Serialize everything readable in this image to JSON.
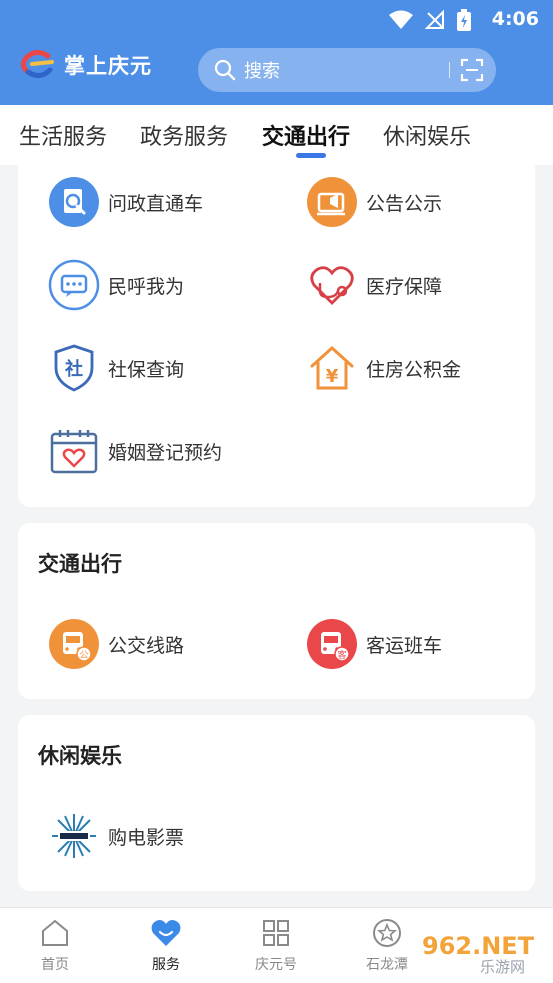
{
  "status": {
    "time": "4:06"
  },
  "header": {
    "app_name": "掌上庆元",
    "search_placeholder": "搜索"
  },
  "tabs": [
    {
      "label": "生活服务"
    },
    {
      "label": "政务服务"
    },
    {
      "label": "交通出行",
      "active": true
    },
    {
      "label": "休闲娱乐"
    }
  ],
  "gov_items": [
    {
      "label": "问政直通车",
      "icon": "clipboard-search-icon"
    },
    {
      "label": "公告公示",
      "icon": "announcement-icon"
    },
    {
      "label": "民呼我为",
      "icon": "chat-bubble-icon"
    },
    {
      "label": "医疗保障",
      "icon": "heart-stethoscope-icon"
    },
    {
      "label": "社保查询",
      "icon": "shield-social-icon"
    },
    {
      "label": "住房公积金",
      "icon": "house-yuan-icon"
    },
    {
      "label": "婚姻登记预约",
      "icon": "calendar-heart-icon"
    }
  ],
  "traffic": {
    "title": "交通出行",
    "items": [
      {
        "label": "公交线路",
        "icon": "bus-icon",
        "badge": "公"
      },
      {
        "label": "客运班车",
        "icon": "coach-icon",
        "badge": "客"
      }
    ]
  },
  "leisure": {
    "title": "休闲娱乐",
    "items": [
      {
        "label": "购电影票",
        "icon": "cinema-logo-icon"
      }
    ]
  },
  "bottom_nav": [
    {
      "label": "首页",
      "icon": "home-icon"
    },
    {
      "label": "服务",
      "icon": "heart-service-icon",
      "active": true
    },
    {
      "label": "庆元号",
      "icon": "grid-icon"
    },
    {
      "label": "石龙潭",
      "icon": "star-circle-icon"
    }
  ],
  "watermark": {
    "text": "962.NET",
    "sub": "乐游网"
  },
  "colors": {
    "primary": "#4d8fe7",
    "tab_accent": "#3b78e7",
    "orange": "#f0923a",
    "red": "#e9474a"
  }
}
